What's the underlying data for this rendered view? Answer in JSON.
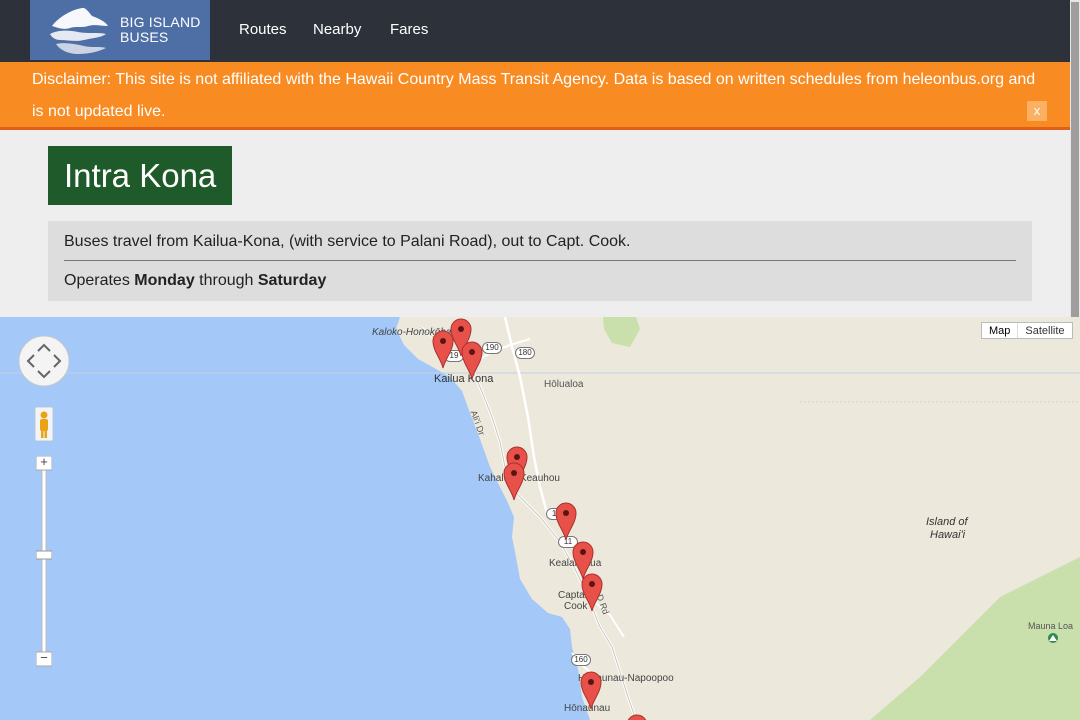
{
  "nav": {
    "brand_line1": "BIG ISLAND",
    "brand_line2": "BUSES",
    "links": [
      "Routes",
      "Nearby",
      "Fares"
    ]
  },
  "disclaimer": {
    "text": "Disclaimer: This site is not affiliated with the Hawaii Country Mass Transit Agency. Data is based on written schedules from heleonbus.org and is not updated live.",
    "close_label": "x"
  },
  "route": {
    "title": "Intra Kona",
    "description": "Buses travel from Kailua-Kona, (with service to Palani Road), out to Capt. Cook.",
    "operates_prefix": "Operates ",
    "operates_start": "Monday",
    "operates_mid": " through ",
    "operates_end": "Saturday"
  },
  "map": {
    "type_buttons": [
      "Map",
      "Satellite"
    ],
    "active_type": "Map",
    "zoom_in": "+",
    "zoom_out": "−",
    "labels": {
      "kaloko": "Kaloko-Honokōhau",
      "kailua_kona": "Kailua Kona",
      "holualoa": "Hōlualoa",
      "alii_dr": "Ali'i Dr",
      "kahaluu": "Kahalu'u-Keauhou",
      "kealakekua": "Kealakekua",
      "captain_cook_1": "Captain",
      "captain_cook_2": "Cook",
      "d_rd": "D Rd",
      "honaunau_napoopoo": "Hōnaunau-Napoopoo",
      "honaunau": "Hōnaunau",
      "island_1": "Island of",
      "island_2": "Hawai'i",
      "mauna_loa": "Mauna Loa"
    },
    "shields": [
      "19",
      "190",
      "180",
      "11",
      "11",
      "160"
    ],
    "stop_count": 11,
    "colors": {
      "ocean": "#a4c8f7",
      "land": "#ece8dc",
      "park": "#c9e0ac",
      "pin": "#e8504a"
    }
  }
}
